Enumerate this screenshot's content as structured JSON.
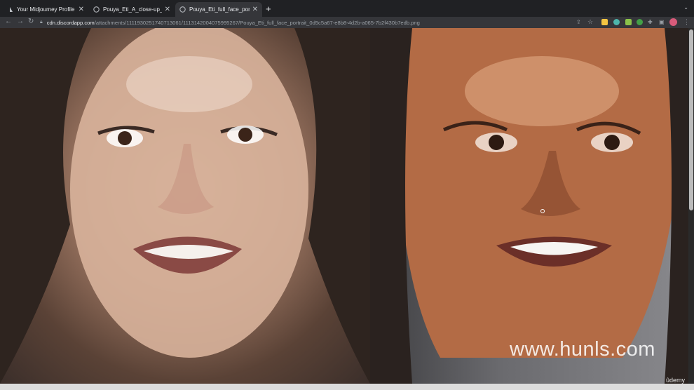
{
  "tabs": [
    {
      "title": "Your Midjourney Profile",
      "active": false
    },
    {
      "title": "Pouya_Eti_A_close-up_image_...",
      "active": false
    },
    {
      "title": "Pouya_Eti_full_face_portrait_0...",
      "active": true
    }
  ],
  "address_bar": {
    "host": "cdn.discordapp.com",
    "path": "/attachments/1111930251740713061/1113142004075995267/Pouya_Eti_full_face_portrait_0d5c5a67-e8b8-4d2b-a065-7b2f430b7edb.png"
  },
  "watermark": "www.hunls.com",
  "brand_badge": "ûdemy",
  "colors": {
    "tab_bg": "#202124",
    "active_tab": "#35363a",
    "text": "#e8eaed"
  }
}
